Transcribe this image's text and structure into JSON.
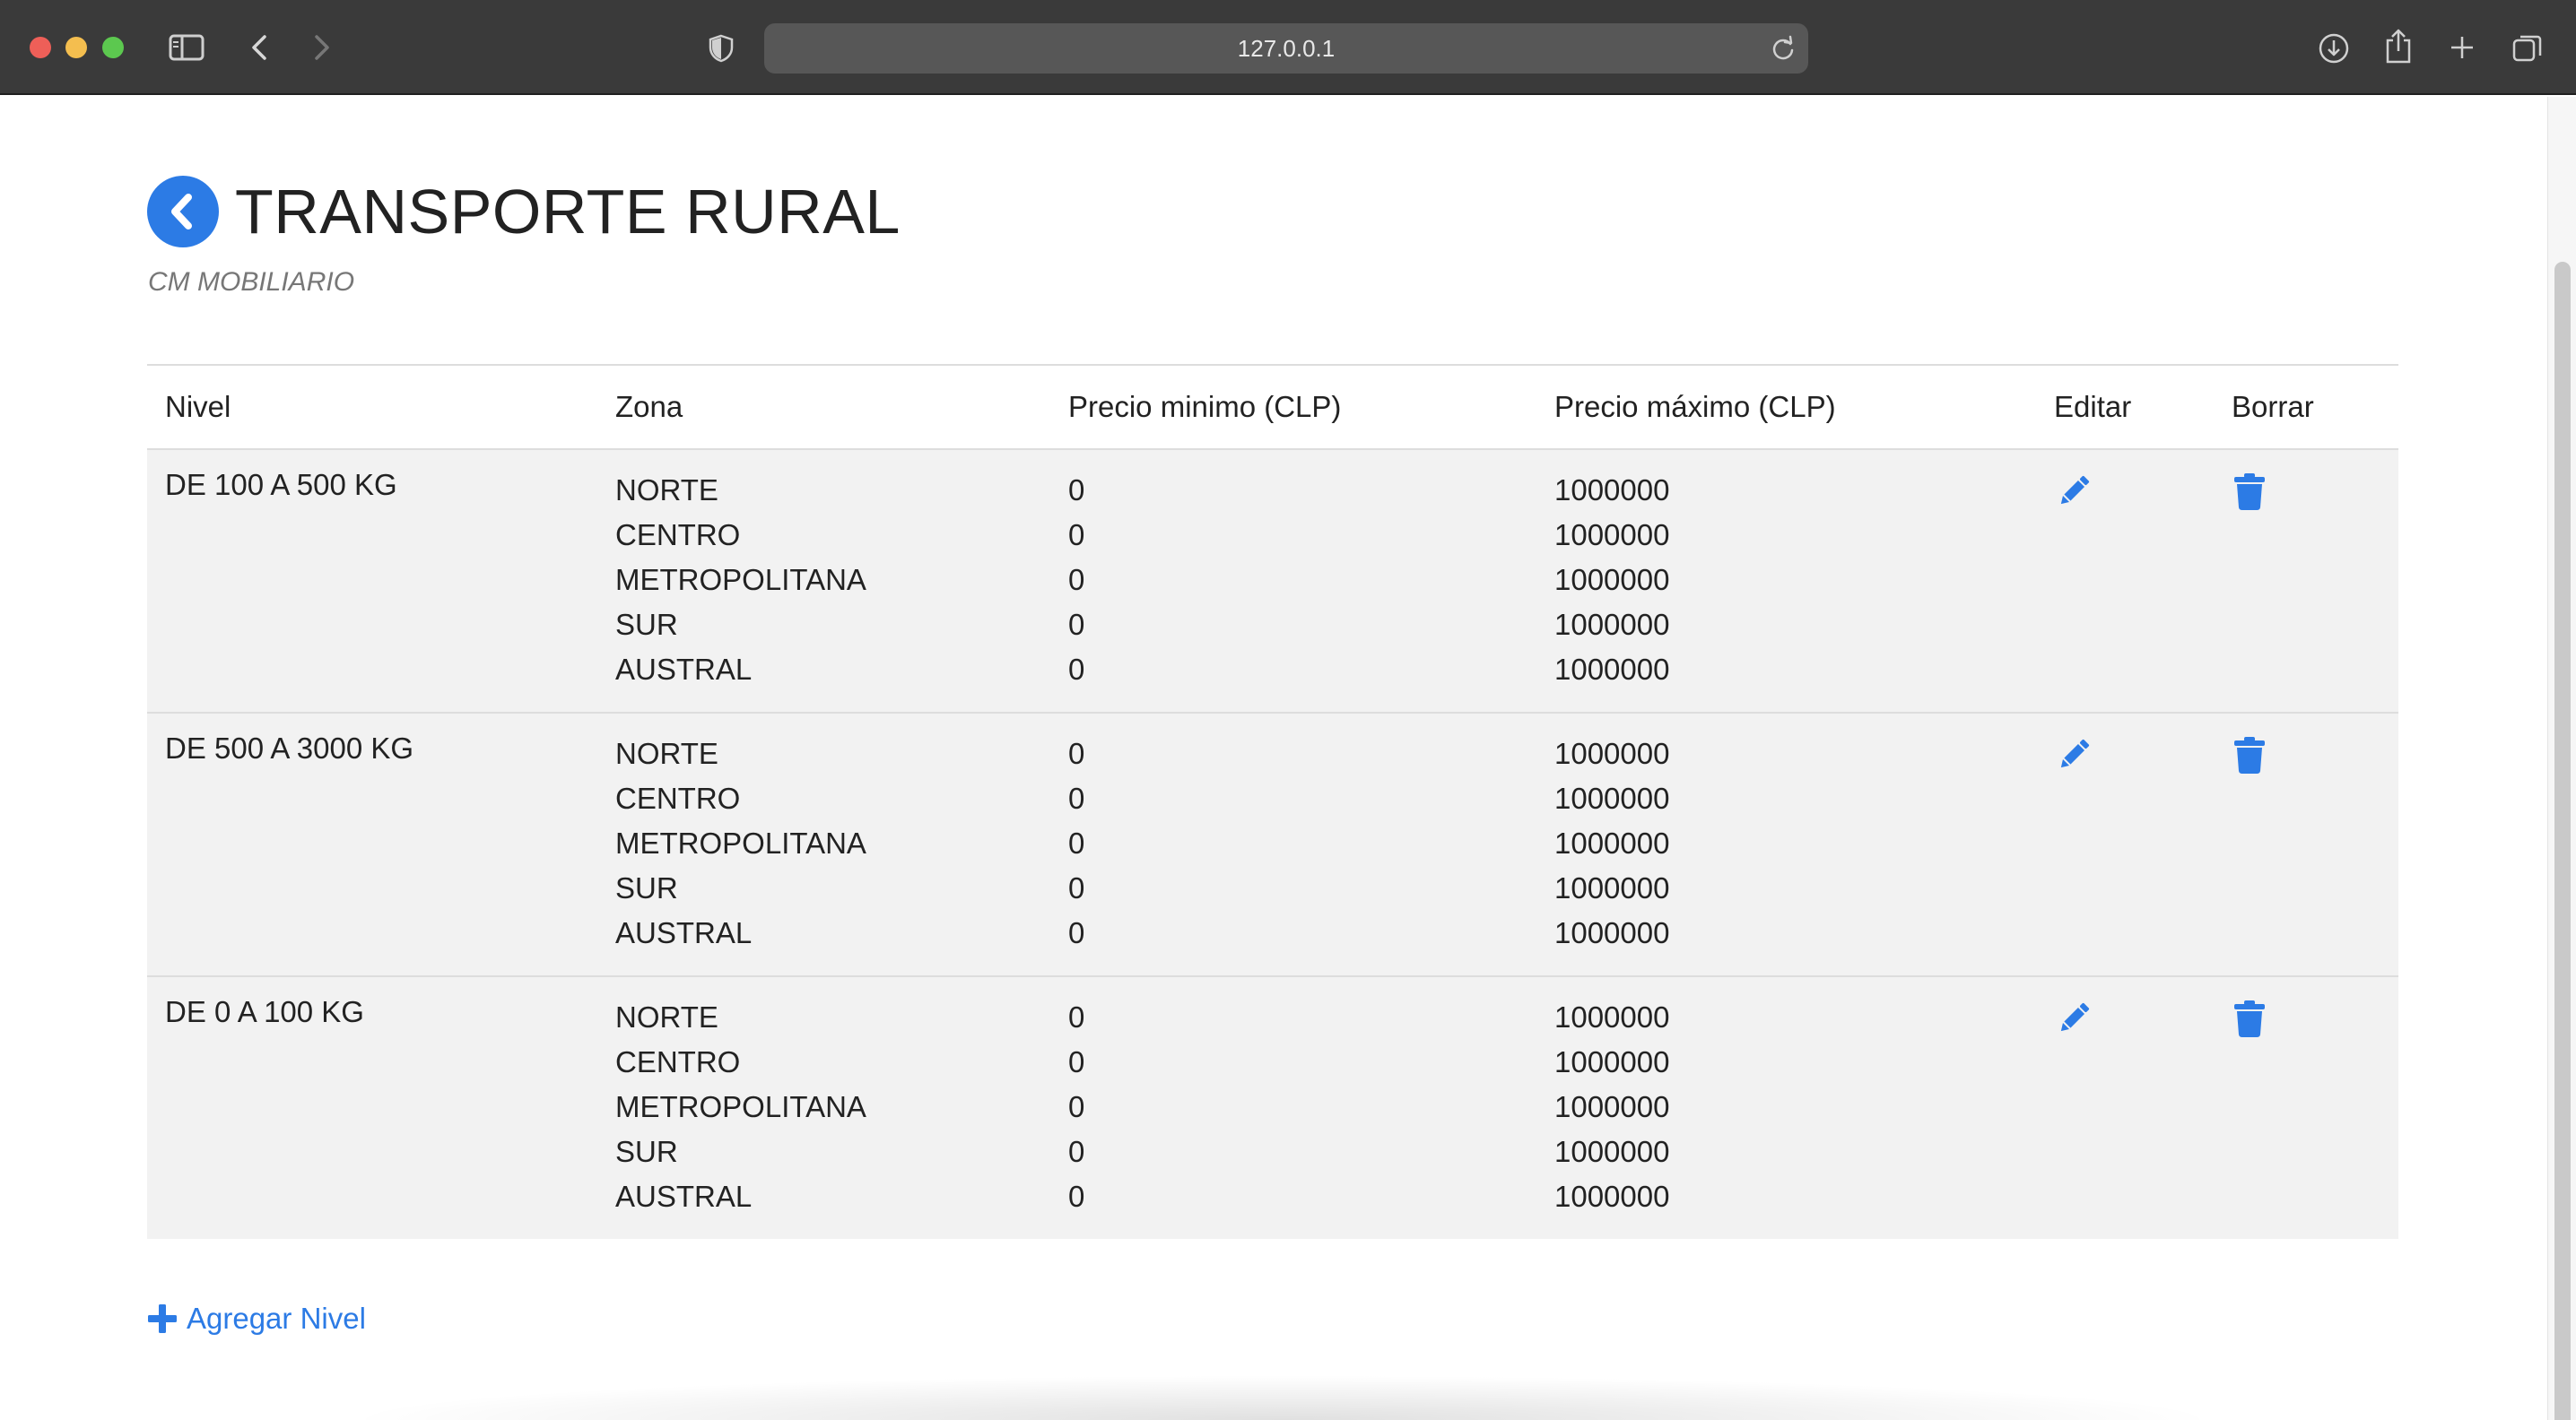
{
  "browser": {
    "url": "127.0.0.1",
    "icons": [
      "sidebar-icon",
      "back-icon",
      "forward-icon",
      "shield-icon",
      "reload-icon",
      "download-icon",
      "share-icon",
      "new-tab-icon",
      "tabs-overview-icon"
    ]
  },
  "page": {
    "title": "TRANSPORTE RURAL",
    "subtitle": "CM MOBILIARIO",
    "accent_color": "#2c7be5"
  },
  "table": {
    "headers": {
      "nivel": "Nivel",
      "zona": "Zona",
      "precio_min": "Precio minimo (CLP)",
      "precio_max": "Precio máximo (CLP)",
      "editar": "Editar",
      "borrar": "Borrar"
    },
    "rows": [
      {
        "nivel": "DE 100 A 500 KG",
        "zonas": [
          "NORTE",
          "CENTRO",
          "METROPOLITANA",
          "SUR",
          "AUSTRAL"
        ],
        "min": [
          "0",
          "0",
          "0",
          "0",
          "0"
        ],
        "max": [
          "1000000",
          "1000000",
          "1000000",
          "1000000",
          "1000000"
        ]
      },
      {
        "nivel": "DE 500 A 3000 KG",
        "zonas": [
          "NORTE",
          "CENTRO",
          "METROPOLITANA",
          "SUR",
          "AUSTRAL"
        ],
        "min": [
          "0",
          "0",
          "0",
          "0",
          "0"
        ],
        "max": [
          "1000000",
          "1000000",
          "1000000",
          "1000000",
          "1000000"
        ]
      },
      {
        "nivel": "DE 0 A 100 KG",
        "zonas": [
          "NORTE",
          "CENTRO",
          "METROPOLITANA",
          "SUR",
          "AUSTRAL"
        ],
        "min": [
          "0",
          "0",
          "0",
          "0",
          "0"
        ],
        "max": [
          "1000000",
          "1000000",
          "1000000",
          "1000000",
          "1000000"
        ]
      }
    ]
  },
  "actions": {
    "add_label": "Agregar Nivel"
  }
}
